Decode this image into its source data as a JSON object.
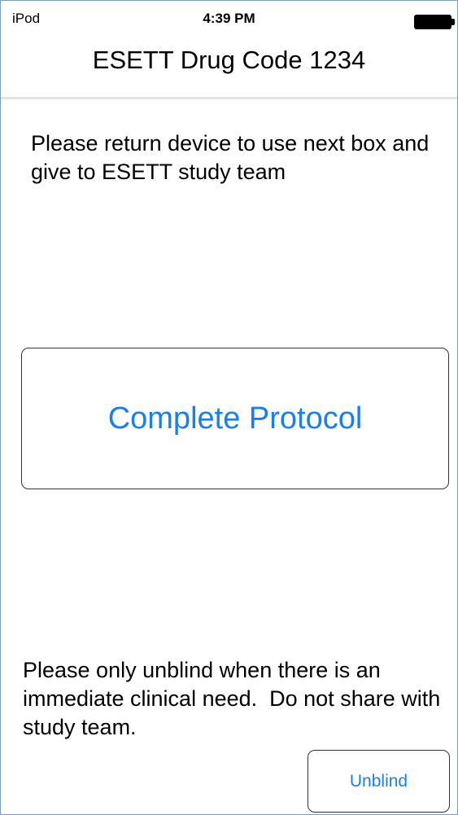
{
  "status_bar": {
    "carrier": "iPod",
    "time": "4:39 PM",
    "battery_icon": "battery-full-icon"
  },
  "nav": {
    "title": "ESETT Drug Code 1234"
  },
  "main": {
    "instruction": "Please return device to use next box and give to ESETT study team",
    "complete_button_label": "Complete Protocol",
    "warning": "Please only unblind when there is an immediate clinical need.  Do not share with study team.",
    "unblind_button_label": "Unblind"
  },
  "colors": {
    "accent": "#1a7ef2",
    "frame_border": "#7a9cc6",
    "divider": "#e4e4e4"
  }
}
